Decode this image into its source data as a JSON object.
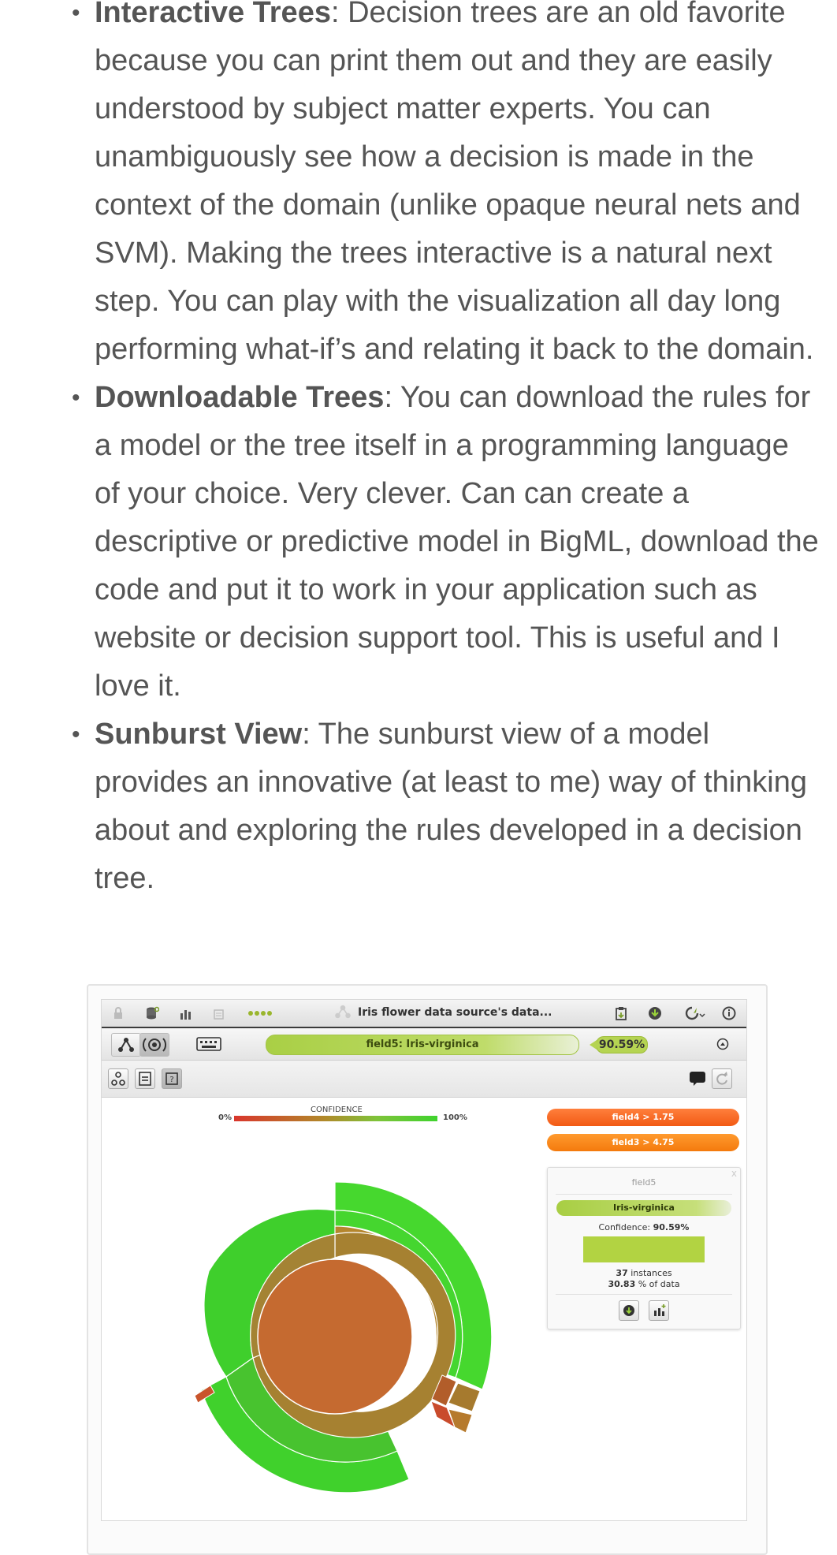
{
  "items": [
    {
      "term": "Interactive Trees",
      "text": ": Decision trees are an old favorite because you can print them out and they are easily understood by subject matter experts. You can unambiguously see how a decision is made in the context of the domain (unlike opaque neural nets and SVM). Making the trees interactive is a natural next step. You can play with the visualization all day long performing what-if’s and relating it back to the domain."
    },
    {
      "term": "Downloadable Trees",
      "text": ": You can download the rules for a model or the tree itself in a programming language of your choice. Very clever. Can can create a descriptive or predictive model in BigML, download the code and put it to work in your application such as website or decision support tool. This is useful and I love it."
    },
    {
      "term": "Sunburst View",
      "text": ": The sunburst view of a model provides an innovative (at least to me) way of thinking about and exploring the rules developed in a decision tree."
    }
  ],
  "screenshot": {
    "title": "Iris flower data source's data...",
    "prediction": "field5: Iris-virginica",
    "prediction_pct": "90.59%",
    "confidence_label": "CONFIDENCE",
    "confidence_min": "0%",
    "confidence_max": "100%",
    "rules": [
      "field4 > 1.75",
      "field3 > 4.75"
    ],
    "panel": {
      "field": "field5",
      "class": "Iris-virginica",
      "confidence_label": "Confidence: ",
      "confidence_value": "90.59%",
      "instances_count": "37",
      "instances_label": " instances",
      "data_pct": "30.83",
      "data_label": " % of data",
      "close": "x"
    },
    "icons": [
      "lock-icon",
      "database-icon",
      "chart-icon",
      "document-icon",
      "dots-icon",
      "tree-icon",
      "clipboard-icon",
      "download-cloud-icon",
      "sync-icon",
      "info-icon",
      "tree-view-icon",
      "sunburst-icon",
      "keyboard-icon",
      "collapse-icon",
      "node-icon",
      "filter-icon",
      "help-icon",
      "comment-icon",
      "refresh-icon"
    ],
    "colors": {
      "prediction_green": "#b5d452",
      "rule_orange": "#f25a14",
      "ring_green": "#3fd32e",
      "center_orange": "#c56a30"
    }
  }
}
